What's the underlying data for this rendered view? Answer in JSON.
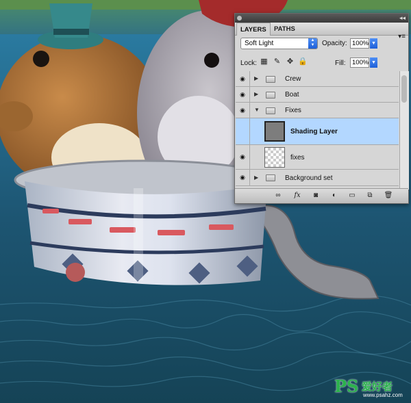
{
  "panel": {
    "tabs": [
      "LAYERS",
      "PATHS"
    ],
    "blend_mode": "Soft Light",
    "opacity_label": "Opacity:",
    "opacity_value": "100%",
    "lock_label": "Lock:",
    "fill_label": "Fill:",
    "fill_value": "100%",
    "layers": [
      {
        "name": "Crew",
        "kind": "group",
        "visible": true,
        "expanded": false
      },
      {
        "name": "Boat",
        "kind": "group",
        "visible": true,
        "expanded": false
      },
      {
        "name": "Fixes",
        "kind": "group",
        "visible": true,
        "expanded": true
      },
      {
        "name": "Shading Layer",
        "kind": "layer",
        "visible": false,
        "selected": true
      },
      {
        "name": "fixes",
        "kind": "layer",
        "visible": true
      },
      {
        "name": "Background set",
        "kind": "group",
        "visible": true,
        "expanded": false
      }
    ]
  },
  "watermark": {
    "brand": "PS",
    "chinese": "爱好者",
    "url": "www.psahz.com"
  },
  "colors": {
    "water": "#1d5572",
    "selection": "#b3d7ff",
    "accent": "#2b6fe0"
  }
}
